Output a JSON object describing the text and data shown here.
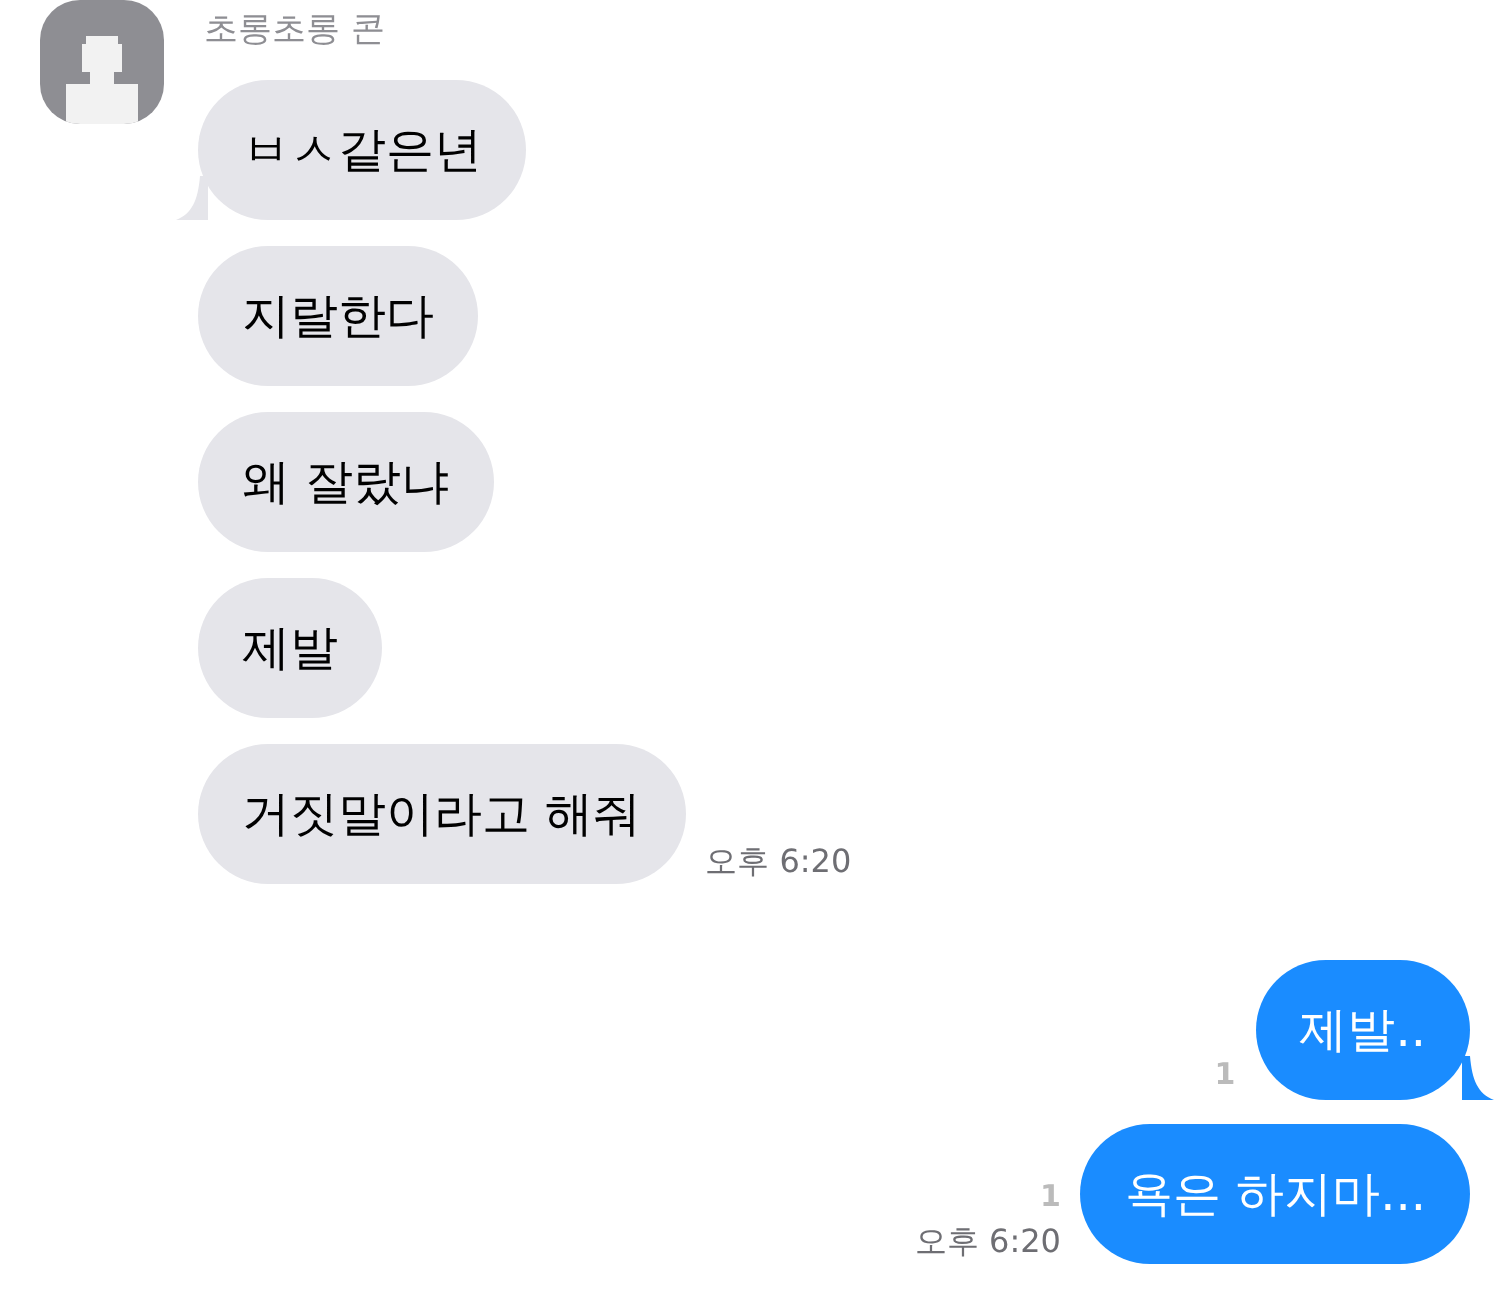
{
  "incoming": {
    "sender": "초롱초롱 콘",
    "messages": [
      {
        "text": "ㅂㅅ같은년",
        "tail": true
      },
      {
        "text": "지랄한다",
        "tail": false
      },
      {
        "text": "왜 잘랐냐",
        "tail": false
      },
      {
        "text": "제발",
        "tail": false
      },
      {
        "text": "거짓말이라고 해줘",
        "tail": false
      }
    ],
    "time": "오후 6:20"
  },
  "outgoing": {
    "messages": [
      {
        "text": "제발..",
        "tail": true,
        "unread": "1"
      },
      {
        "text": "욕은 하지마...",
        "tail": false,
        "unread": "1"
      }
    ],
    "time": "오후 6:20"
  }
}
